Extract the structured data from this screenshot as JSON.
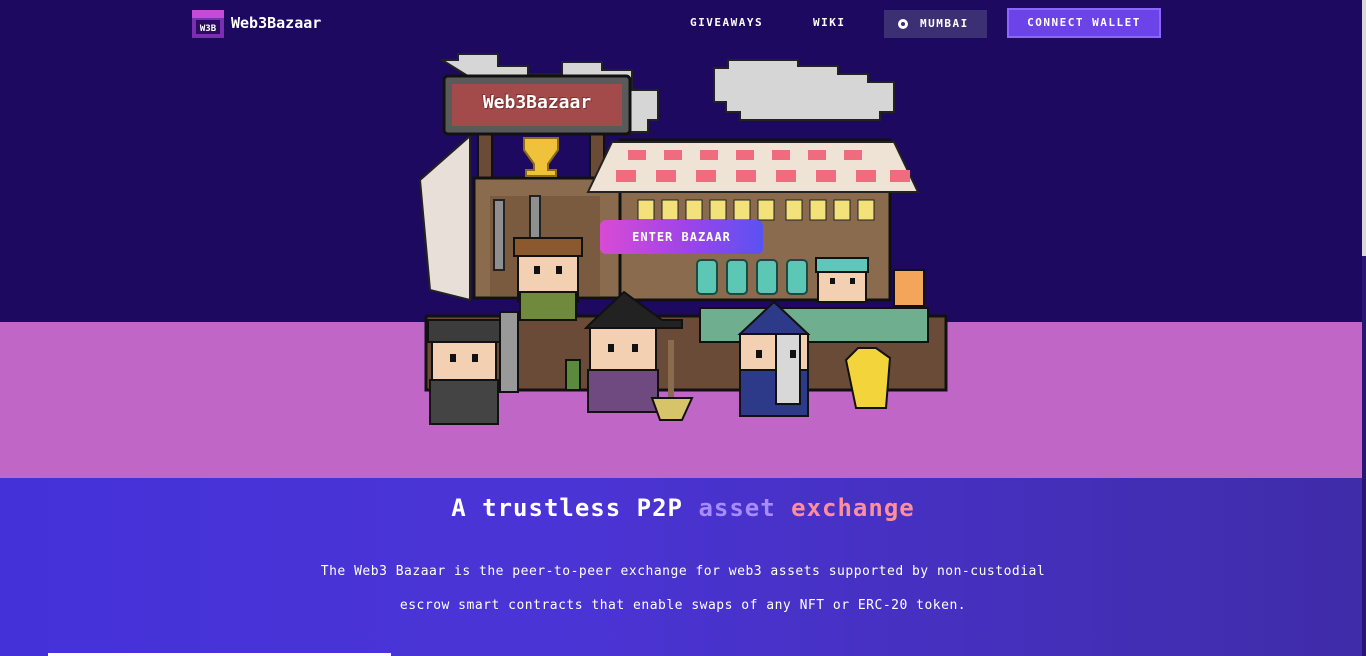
{
  "nav": {
    "brand": "Web3Bazaar",
    "logo_text": "W3B",
    "links": [
      "GIVEAWAYS",
      "WIKI"
    ],
    "network": "MUMBAI",
    "connect": "CONNECT WALLET"
  },
  "hero": {
    "sign": "Web3Bazaar",
    "enter_button": "ENTER BAZAAR"
  },
  "content": {
    "headline_part1": "A trustless P2P ",
    "headline_part2": "asset",
    "headline_part3": " exchange",
    "paragraph_line1": "The Web3 Bazaar is the peer-to-peer exchange for web3 assets supported by non-custodial",
    "paragraph_line2": "escrow smart contracts that enable swaps of any NFT or ERC-20 token."
  },
  "colors": {
    "nav_bg": "#1d0960",
    "ground": "#c066c7",
    "accent": "#6b43e8",
    "section_bg": "#4432d8"
  }
}
